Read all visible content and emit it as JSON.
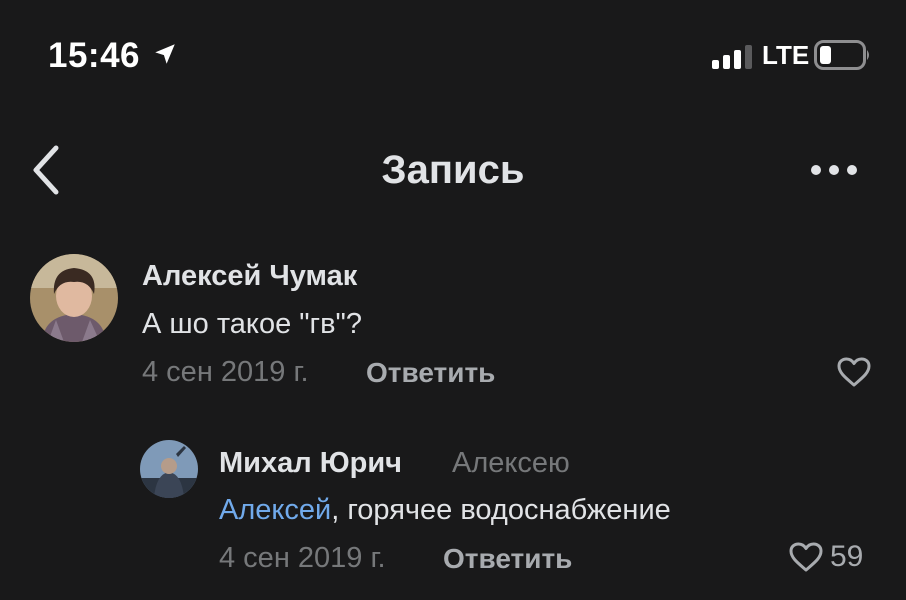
{
  "status_bar": {
    "time": "15:46",
    "network": "LTE",
    "icons": [
      "location-arrow-icon",
      "signal-icon",
      "battery-icon"
    ]
  },
  "nav": {
    "title": "Запись",
    "back_icon": "chevron-left-icon",
    "more_icon": "more-dots-icon"
  },
  "comments": [
    {
      "author": "Алексей Чумак",
      "text": "А шо такое \"гв\"?",
      "date": "4 сен 2019 г.",
      "reply_label": "Ответить",
      "likes": ""
    },
    {
      "author": "Михал Юрич",
      "reply_to": "Алексею",
      "mention": "Алексей",
      "text": ", горячее водоснабжение",
      "date": "4 сен 2019 г.",
      "reply_label": "Ответить",
      "likes": "59"
    }
  ],
  "colors": {
    "background": "#19191a",
    "text_primary": "#e1e3e6",
    "text_secondary": "#76787a",
    "mention": "#71aaeb"
  }
}
